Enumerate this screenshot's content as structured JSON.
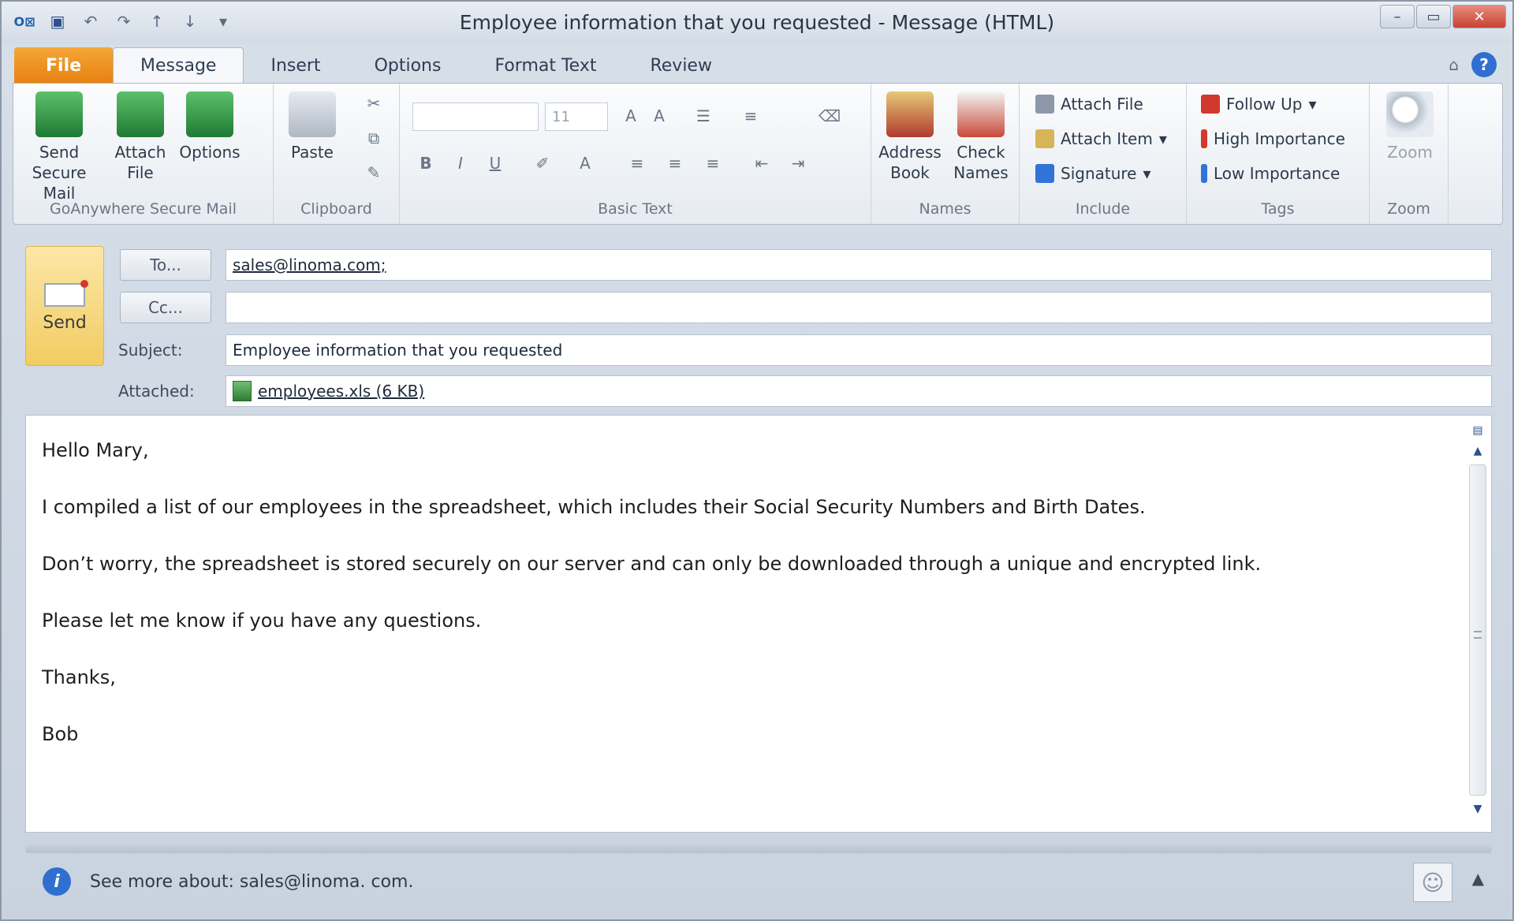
{
  "window": {
    "title": "Employee information that you requested - Message (HTML)"
  },
  "tabs": [
    {
      "label": "File"
    },
    {
      "label": "Message"
    },
    {
      "label": "Insert"
    },
    {
      "label": "Options"
    },
    {
      "label": "Format Text"
    },
    {
      "label": "Review"
    }
  ],
  "ribbon": {
    "secure_mail": {
      "group_label": "GoAnywhere Secure Mail",
      "send_secure": "Send Secure Mail",
      "attach_file": "Attach File",
      "options": "Options"
    },
    "clipboard": {
      "group_label": "Clipboard",
      "paste": "Paste"
    },
    "basic_text": {
      "group_label": "Basic Text",
      "font_size": "11",
      "bold": "B",
      "italic": "I",
      "underline": "U",
      "grow_font": "A",
      "shrink_font": "A",
      "font_color": "A"
    },
    "names": {
      "group_label": "Names",
      "address_book": "Address Book",
      "check_names": "Check Names"
    },
    "include": {
      "group_label": "Include",
      "attach_file": "Attach File",
      "attach_item": "Attach Item",
      "signature": "Signature"
    },
    "tags": {
      "group_label": "Tags",
      "follow_up": "Follow Up",
      "high_importance": "High Importance",
      "low_importance": "Low Importance"
    },
    "zoom": {
      "group_label": "Zoom",
      "zoom": "Zoom"
    }
  },
  "compose": {
    "send_label": "Send",
    "to_button": "To...",
    "cc_button": "Cc...",
    "subject_label": "Subject:",
    "attached_label": "Attached:",
    "to_value": "sales@linoma.com;",
    "cc_value": "",
    "subject_value": "Employee information that you requested",
    "attachment": "employees.xls (6 KB)"
  },
  "body": {
    "lines": [
      "Hello Mary,",
      "I compiled a list of our employees in the spreadsheet, which includes their Social Security Numbers and Birth Dates.",
      "Don’t worry, the spreadsheet is stored securely on our server and can only be downloaded through a unique and encrypted link.",
      "Please let me know if you have any questions.",
      "Thanks,",
      "Bob"
    ]
  },
  "people_pane": {
    "text": "See more about: sales@linoma. com."
  }
}
